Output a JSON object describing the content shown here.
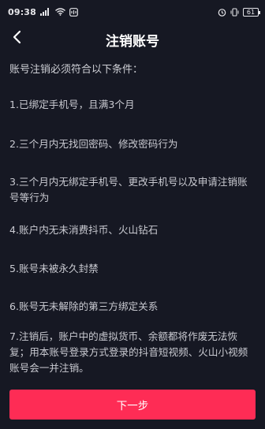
{
  "status_bar": {
    "time": "09:38",
    "battery": "61",
    "icons": [
      "signal-icon",
      "wifi-icon",
      "notification-icon",
      "alarm-icon",
      "battery-icon"
    ]
  },
  "nav": {
    "title": "注销账号",
    "back_icon": "chevron-left-icon"
  },
  "content": {
    "intro": "账号注销必须符合以下条件：",
    "conditions": [
      "1.已绑定手机号，且满3个月",
      "2.三个月内无找回密码、修改密码行为",
      "3.三个月内无绑定手机号、更改手机号以及申请注销账号等行为",
      "4.账户内无未消费抖币、火山钻石",
      "5.账号未被永久封禁",
      "6.账号无未解除的第三方绑定关系",
      "7.注销后，账户中的虚拟货币、余额都将作废无法恢复；用本账号登录方式登录的抖音短视频、火山小视频账号会一并注销。"
    ]
  },
  "footer": {
    "next_label": "下一步"
  },
  "colors": {
    "background": "#161823",
    "accent": "#fe2c55",
    "text": "#cfd0d6"
  }
}
